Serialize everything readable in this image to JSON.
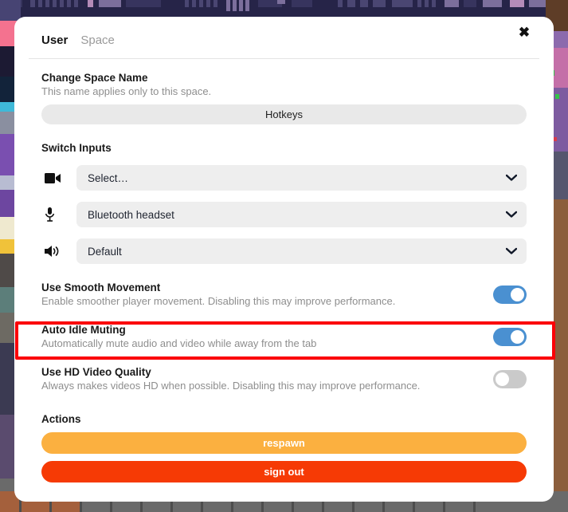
{
  "window": {
    "tabs": [
      {
        "label": "User",
        "active": true
      },
      {
        "label": "Space",
        "active": false
      }
    ],
    "close_label": "✖"
  },
  "change_space_name": {
    "title": "Change Space Name",
    "subtitle": "This name applies only to this space.",
    "input_value": "Hotkeys",
    "input_placeholder": "Hotkeys"
  },
  "switch_inputs": {
    "title": "Switch Inputs",
    "rows": [
      {
        "icon": "video-camera-icon",
        "value": "Select…",
        "chevron": "❯"
      },
      {
        "icon": "microphone-icon",
        "value": "Bluetooth headset",
        "chevron": "❯"
      },
      {
        "icon": "speaker-icon",
        "value": "Default",
        "chevron": "❯"
      }
    ]
  },
  "settings": [
    {
      "title": "Use Smooth Movement",
      "subtitle": "Enable smoother player movement. Disabling this may improve performance.",
      "state": "on"
    },
    {
      "title": "Auto Idle Muting",
      "subtitle": "Automatically mute audio and video while away from the tab",
      "state": "on",
      "highlighted": true
    },
    {
      "title": "Use HD Video Quality",
      "subtitle": "Always makes videos HD when possible. Disabling this may improve performance.",
      "state": "off"
    }
  ],
  "actions": {
    "title": "Actions",
    "buttons": [
      {
        "label": "respawn",
        "color": "#fbb040"
      },
      {
        "label": "sign out",
        "color": "#f63a05"
      }
    ]
  },
  "colors": {
    "toggle_on": "#4a90d1",
    "toggle_off": "#cacaca",
    "highlight": "#fb0007",
    "respawn": "#fbb040",
    "sign_out": "#f63a05",
    "field_bg": "#eeeeee"
  }
}
